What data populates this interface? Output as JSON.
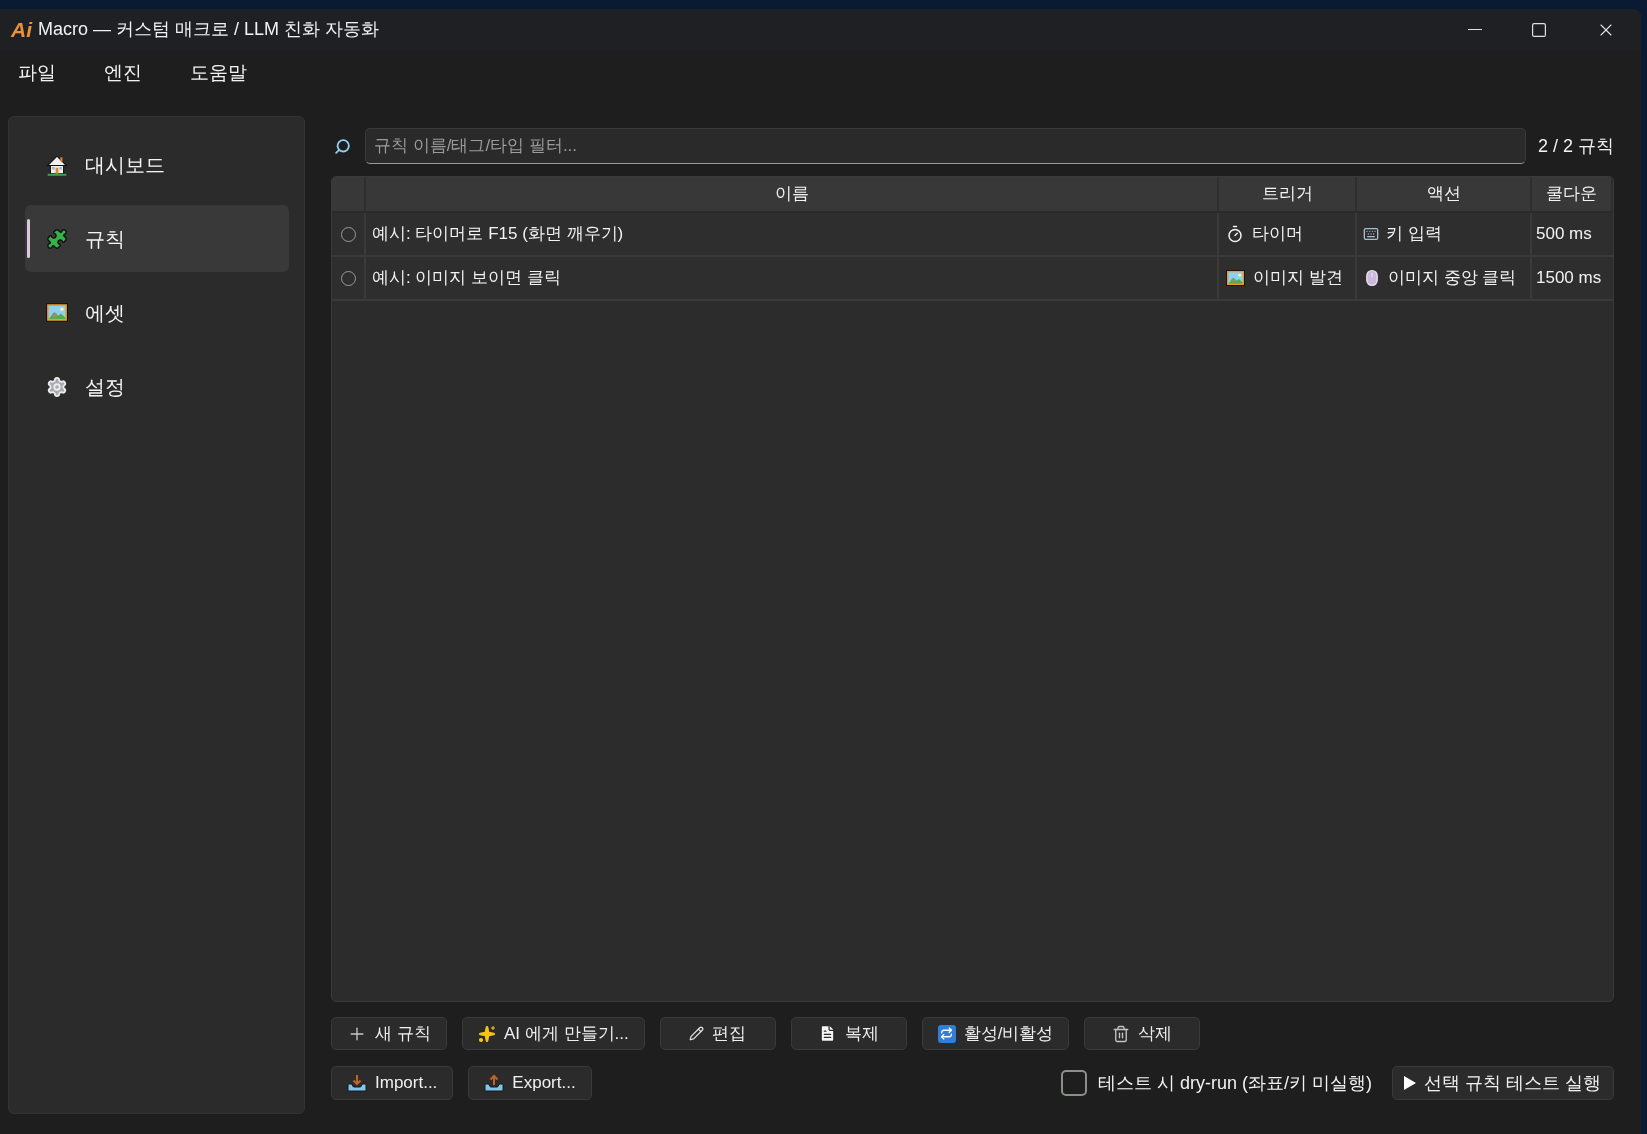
{
  "window": {
    "logo": "Ai",
    "title": "Macro — 커스텀 매크로 / LLM 친화 자동화"
  },
  "menu": [
    {
      "label": "파일"
    },
    {
      "label": "엔진"
    },
    {
      "label": "도움말"
    }
  ],
  "sidebar": {
    "items": [
      {
        "kind": "dashboard",
        "label": "대시보드",
        "selected": false
      },
      {
        "kind": "rules",
        "label": "규칙",
        "selected": true
      },
      {
        "kind": "assets",
        "label": "에셋",
        "selected": false
      },
      {
        "kind": "settings",
        "label": "설정",
        "selected": false
      }
    ]
  },
  "filter": {
    "placeholder": "규칙 이름/태그/타입 필터...",
    "count": "2 / 2 규칙"
  },
  "table": {
    "columns": [
      "이름",
      "트리거",
      "액션",
      "쿨다운"
    ],
    "rows": [
      {
        "selected": false,
        "name": "예시: 타이머로 F15 (화면 깨우기)",
        "trigger": {
          "kind": "timer",
          "label": "타이머"
        },
        "action": {
          "kind": "key",
          "label": "키 입력"
        },
        "cooldown": "500 ms"
      },
      {
        "selected": false,
        "name": "예시: 이미지 보이면 클릭",
        "trigger": {
          "kind": "image",
          "label": "이미지 발견"
        },
        "action": {
          "kind": "click",
          "label": "이미지 중앙 클릭"
        },
        "cooldown": "1500 ms"
      }
    ]
  },
  "toolbar": [
    {
      "kind": "new",
      "label": "새 규칙"
    },
    {
      "kind": "ai",
      "label": "AI 에게 만들기..."
    },
    {
      "kind": "edit",
      "label": "편집"
    },
    {
      "kind": "duplicate",
      "label": "복제"
    },
    {
      "kind": "toggle",
      "label": "활성/비활성"
    },
    {
      "kind": "delete",
      "label": "삭제"
    }
  ],
  "io_buttons": [
    {
      "kind": "import",
      "label": "Import..."
    },
    {
      "kind": "export",
      "label": "Export..."
    }
  ],
  "dry_run": {
    "label": "테스트 시 dry-run (좌표/키 미실행)",
    "checked": false
  },
  "run_button": {
    "label": "선택 규칙 테스트 실행"
  }
}
